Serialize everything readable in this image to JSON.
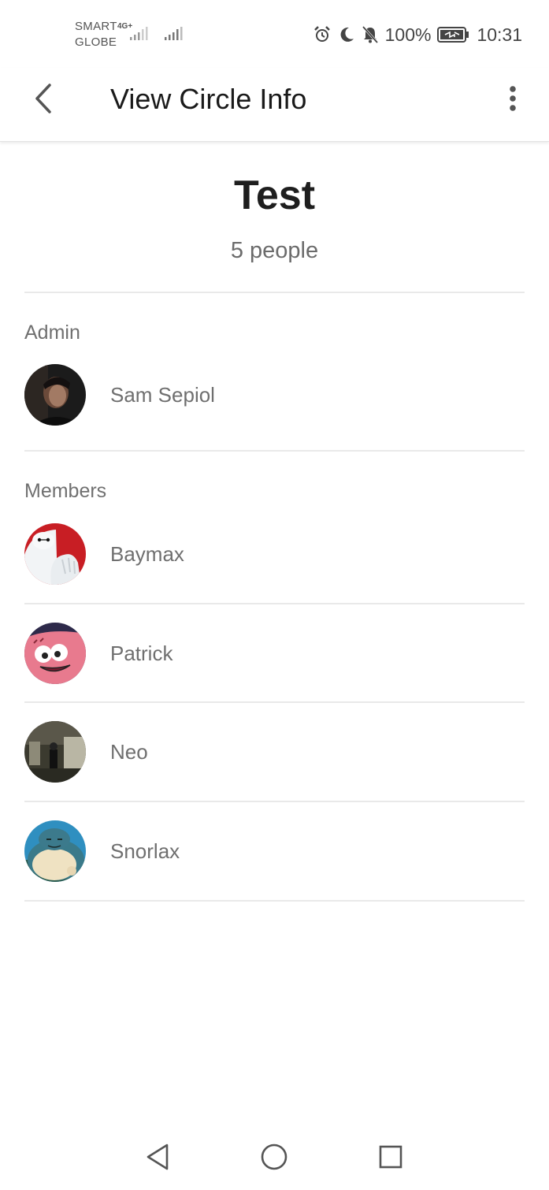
{
  "status_bar": {
    "carrier_line1": "SMART",
    "carrier_line2": "GLOBE",
    "network_type": "4G+",
    "battery_percent": "100%",
    "time": "10:31",
    "icons": [
      "signal-icon",
      "signal-icon",
      "alarm-icon",
      "moon-icon",
      "bell-off-icon",
      "battery-charging-icon"
    ]
  },
  "app_bar": {
    "title": "View Circle Info",
    "back_icon": "back-arrow-icon",
    "more_icon": "more-vert-icon"
  },
  "circle": {
    "name": "Test",
    "count": "5 people"
  },
  "admin": {
    "label": "Admin",
    "people": [
      {
        "name": "Sam Sepiol",
        "avatar": "photo-dark-portrait"
      }
    ]
  },
  "members": {
    "label": "Members",
    "people": [
      {
        "name": "Baymax",
        "avatar": "baymax-image"
      },
      {
        "name": "Patrick",
        "avatar": "patrick-image"
      },
      {
        "name": "Neo",
        "avatar": "neo-image"
      },
      {
        "name": "Snorlax",
        "avatar": "snorlax-image"
      }
    ]
  },
  "nav_bar": {
    "icons": [
      "nav-back-icon",
      "nav-home-icon",
      "nav-recents-icon"
    ]
  },
  "colors": {
    "background": "#ffffff",
    "title_text": "#1e1e1e",
    "secondary_text": "#6f6f6f",
    "divider": "#e9e9e9"
  }
}
